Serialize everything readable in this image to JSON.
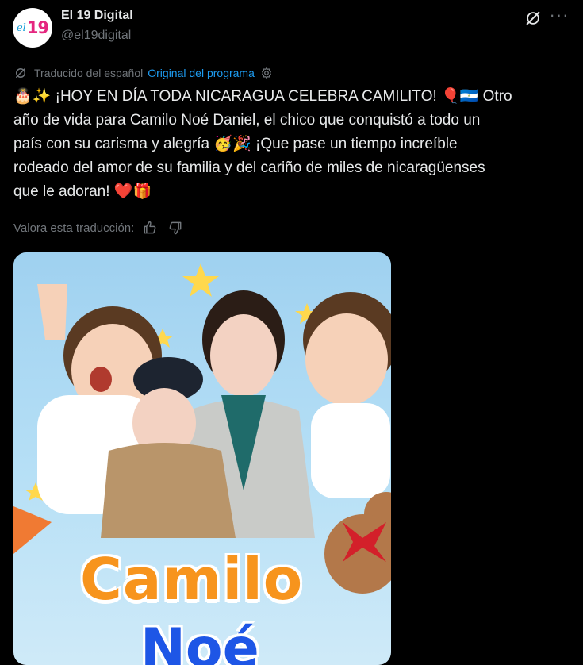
{
  "account": {
    "name": "El 19 Digital",
    "handle": "@el19digital",
    "avatar_text_el": "el",
    "avatar_text_19": "19"
  },
  "translation": {
    "label": "Traducido del español",
    "link": "Original del programa"
  },
  "post": {
    "line1_a": "¡HOY EN DÍA TODA NICARAGUA CELEBRA CAMILITO!",
    "line1_b": "Otro",
    "line2": "año de vida para Camilo Noé Daniel, el chico que conquistó a todo un",
    "line3_a": "país con su carisma y alegría",
    "line3_b": "¡Que pase un tiempo increíble",
    "line4": "rodeado del amor de su familia y del cariño de miles de nicaragüenses",
    "line5": "que le adoran!",
    "emoji_cake": "🎂",
    "emoji_sparkles": "✨",
    "emoji_balloon": "🎈",
    "emoji_flag": "🇳🇮",
    "emoji_party_face": "🥳",
    "emoji_popper": "🎉",
    "emoji_heart": "❤️",
    "emoji_gift": "🎁"
  },
  "rate": {
    "label": "Valora esta traducción:"
  },
  "media": {
    "caption_1": "Camilo",
    "caption_2": "Noé"
  },
  "colors": {
    "background": "#000000",
    "text": "#e7e9ea",
    "muted": "#71767b",
    "link": "#1d9bf0",
    "caption_orange": "#f7941d",
    "caption_blue": "#1e56e6"
  },
  "icons": [
    "grok-icon",
    "more-icon",
    "translate-icon",
    "settings-icon",
    "thumbs-up-icon",
    "thumbs-down-icon"
  ]
}
